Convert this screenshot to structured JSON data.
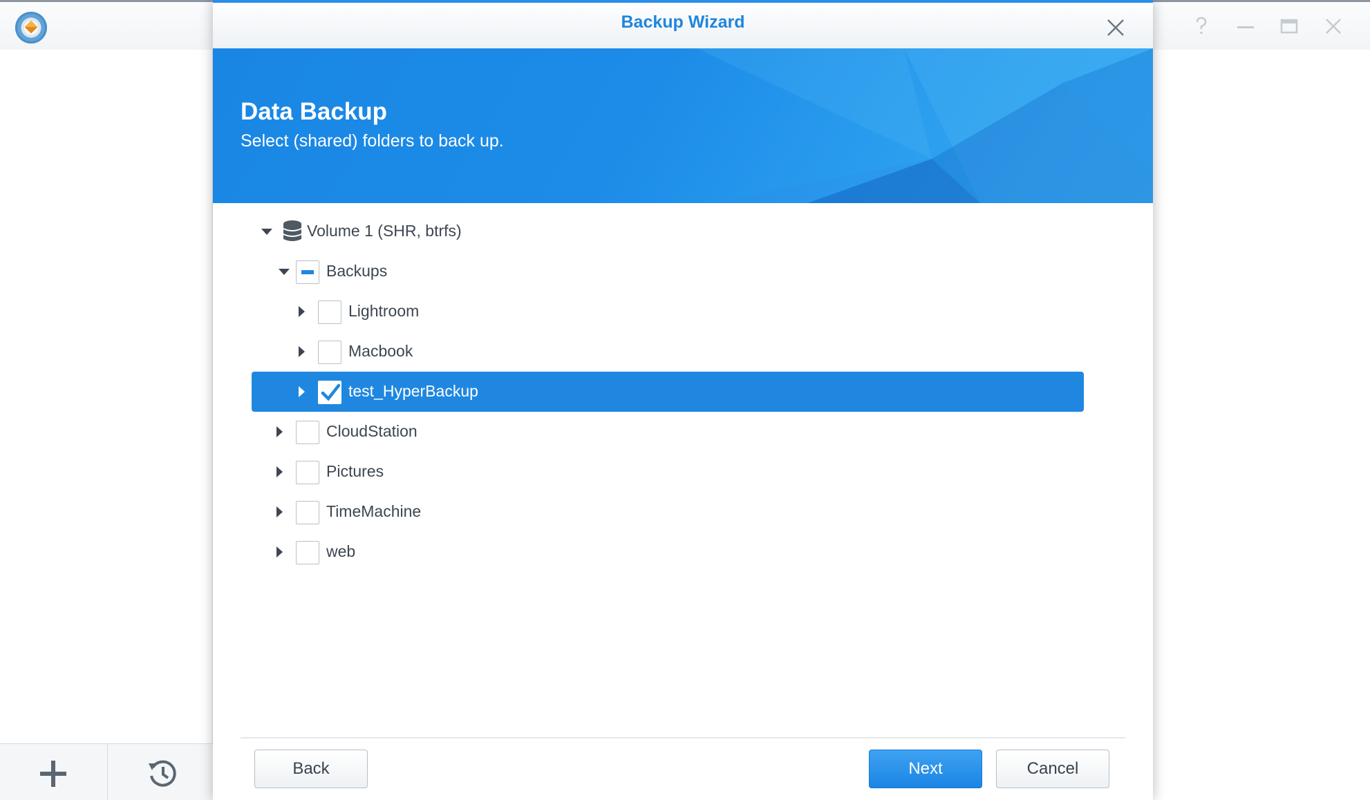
{
  "background_app": {
    "window_controls": [
      "help-icon",
      "minimize-icon",
      "maximize-icon",
      "close-icon"
    ],
    "toolbar": [
      "plus-icon",
      "restore-history-icon"
    ]
  },
  "dialog": {
    "title": "Backup Wizard",
    "banner": {
      "title": "Data Backup",
      "subtitle": "Select (shared) folders to back up."
    },
    "tree": {
      "volume": {
        "label": "Volume 1 (SHR, btrfs)",
        "expanded": true
      },
      "folders": [
        {
          "label": "Backups",
          "level": 1,
          "expanded": true,
          "checked": "partial"
        },
        {
          "label": "Lightroom",
          "level": 2,
          "expanded": false,
          "checked": false
        },
        {
          "label": "Macbook",
          "level": 2,
          "expanded": false,
          "checked": false
        },
        {
          "label": "test_HyperBackup",
          "level": 2,
          "expanded": false,
          "checked": true,
          "selected": true
        },
        {
          "label": "CloudStation",
          "level": 1,
          "expanded": false,
          "checked": false
        },
        {
          "label": "Pictures",
          "level": 1,
          "expanded": false,
          "checked": false
        },
        {
          "label": "TimeMachine",
          "level": 1,
          "expanded": false,
          "checked": false
        },
        {
          "label": "web",
          "level": 1,
          "expanded": false,
          "checked": false
        }
      ]
    },
    "buttons": {
      "back": "Back",
      "next": "Next",
      "cancel": "Cancel"
    },
    "colors": {
      "accent": "#1f87e0",
      "banner": "#1c8ce8"
    }
  }
}
